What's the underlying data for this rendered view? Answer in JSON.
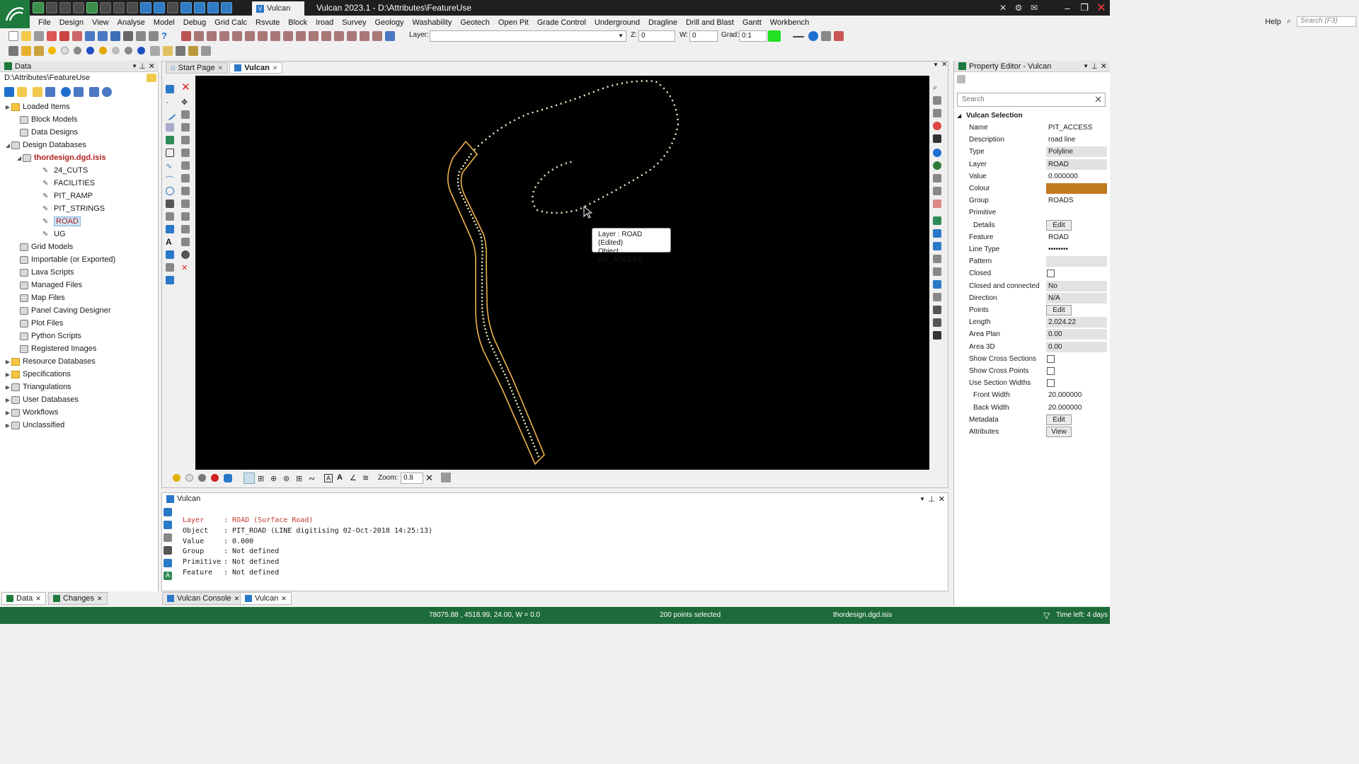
{
  "titlebar": {
    "doc_tab": "Vulcan",
    "title": "Vulcan 2023.1 - D:\\Attributes\\FeatureUse",
    "icons": [
      "tools-icon",
      "gear-icon",
      "mail-icon"
    ]
  },
  "menu": {
    "items": [
      "File",
      "Design",
      "View",
      "Analyse",
      "Model",
      "Debug",
      "Grid Calc",
      "Rsvute",
      "Block",
      "Iroad",
      "Survey",
      "Geology",
      "Washability",
      "Geotech",
      "Open Pit",
      "Grade Control",
      "Underground",
      "Dragline",
      "Drill and Blast",
      "Gantt",
      "Workbench"
    ],
    "help": "Help",
    "search_placeholder": "Search (F3)"
  },
  "toolbar": {
    "layer_label": "Layer:",
    "layer_value": "",
    "z_label": "Z:",
    "z_value": "0",
    "w_label": "W:",
    "w_value": "0",
    "grad_label": "Grad:",
    "grad_value": "0:1",
    "grad_color": "#22e022"
  },
  "data_panel": {
    "title": "Data",
    "path": "D:\\Attributes\\FeatureUse",
    "tree": [
      {
        "label": "Loaded Items",
        "expander": "▶",
        "icon": "fld"
      },
      {
        "label": "Block Models",
        "expander": "",
        "icon": "db"
      },
      {
        "label": "Data Designs",
        "expander": "",
        "icon": "db"
      },
      {
        "label": "Design Databases",
        "expander": "◢",
        "icon": "db"
      },
      {
        "label": "thordesign.dgd.isis",
        "expander": "◢",
        "icon": "db"
      },
      {
        "label": "24_CUTS",
        "expander": "",
        "icon": "lyr"
      },
      {
        "label": "FACILITIES",
        "expander": "",
        "icon": "lyr"
      },
      {
        "label": "PIT_RAMP",
        "expander": "",
        "icon": "lyr"
      },
      {
        "label": "PIT_STRINGS",
        "expander": "",
        "icon": "lyr"
      },
      {
        "label": "ROAD",
        "expander": "",
        "icon": "lyr"
      },
      {
        "label": "UG",
        "expander": "",
        "icon": "lyr"
      },
      {
        "label": "Grid Models",
        "expander": "",
        "icon": "db"
      },
      {
        "label": "Importable (or Exported)",
        "expander": "",
        "icon": "db"
      },
      {
        "label": "Lava Scripts",
        "expander": "",
        "icon": "db"
      },
      {
        "label": "Managed Files",
        "expander": "",
        "icon": "db"
      },
      {
        "label": "Map Files",
        "expander": "",
        "icon": "db"
      },
      {
        "label": "Panel Caving Designer",
        "expander": "",
        "icon": "db"
      },
      {
        "label": "Plot Files",
        "expander": "",
        "icon": "db"
      },
      {
        "label": "Python Scripts",
        "expander": "",
        "icon": "db"
      },
      {
        "label": "Registered Images",
        "expander": "",
        "icon": "db"
      },
      {
        "label": "Resource Databases",
        "expander": "▶",
        "icon": "fld"
      },
      {
        "label": "Specifications",
        "expander": "▶",
        "icon": "fld"
      },
      {
        "label": "Triangulations",
        "expander": "▶",
        "icon": "db"
      },
      {
        "label": "User Databases",
        "expander": "▶",
        "icon": "db"
      },
      {
        "label": "Workflows",
        "expander": "▶",
        "icon": "db"
      },
      {
        "label": "Unclassified",
        "expander": "▶",
        "icon": "db"
      }
    ]
  },
  "view": {
    "tabs": [
      "Start Page",
      "Vulcan"
    ],
    "zoom_label": "Zoom:",
    "zoom_value": "0.8",
    "tooltip_line1": "Layer : ROAD (Edited)",
    "tooltip_line2": "Object : PIT_ACCESS",
    "road_color": "#f0b24a",
    "line_color": "#f5f2c8"
  },
  "console": {
    "title": "Vulcan",
    "lines": [
      {
        "key": "Layer",
        "value": ": ROAD (Surface Road)"
      },
      {
        "key": "Object",
        "value": ": PIT_ROAD (LINE digitising 02-Oct-2018 14:25:13)"
      },
      {
        "key": "Value",
        "value": ": 0.000"
      },
      {
        "key": "Group",
        "value": ": Not defined"
      },
      {
        "key": "Primitive",
        "value": ": Not defined"
      },
      {
        "key": "Feature",
        "value": ": Not defined"
      }
    ]
  },
  "bottom_tabs": {
    "left": [
      "Data",
      "Changes"
    ],
    "center": [
      "Vulcan Console",
      "Vulcan"
    ]
  },
  "property_editor": {
    "title": "Property Editor - Vulcan",
    "search_placeholder": "Search",
    "section": "Vulcan Selection",
    "colour_swatch": "#c07a1e",
    "rows": [
      {
        "name": "Name",
        "value": "PIT_ACCESS",
        "kind": "text"
      },
      {
        "name": "Description",
        "value": "road line",
        "kind": "text"
      },
      {
        "name": "Type",
        "value": "Polyline",
        "kind": "ro"
      },
      {
        "name": "Layer",
        "value": "ROAD",
        "kind": "ro"
      },
      {
        "name": "Value",
        "value": "0.000000",
        "kind": "text"
      },
      {
        "name": "Colour",
        "value": "",
        "kind": "swatch"
      },
      {
        "name": "Group",
        "value": "ROADS",
        "kind": "text"
      },
      {
        "name": "Primitive",
        "value": "",
        "kind": "text"
      },
      {
        "name": "Details",
        "value": "Edit",
        "kind": "btn",
        "indent": true
      },
      {
        "name": "Feature",
        "value": "ROAD",
        "kind": "text"
      },
      {
        "name": "Line Type",
        "value": "••••••••",
        "kind": "text"
      },
      {
        "name": "Pattern",
        "value": "",
        "kind": "ro"
      },
      {
        "name": "Closed",
        "value": "",
        "kind": "chk"
      },
      {
        "name": "Closed and connected",
        "value": "No",
        "kind": "ro"
      },
      {
        "name": "Direction",
        "value": "N/A",
        "kind": "ro"
      },
      {
        "name": "Points",
        "value": "Edit",
        "kind": "btn"
      },
      {
        "name": "Length",
        "value": "2,024.22",
        "kind": "ro"
      },
      {
        "name": "Area Plan",
        "value": "0.00",
        "kind": "ro"
      },
      {
        "name": "Area 3D",
        "value": "0.00",
        "kind": "ro"
      },
      {
        "name": "Show Cross Sections",
        "value": "",
        "kind": "chk"
      },
      {
        "name": "Show Cross Points",
        "value": "",
        "kind": "chk"
      },
      {
        "name": "Use Section Widths",
        "value": "",
        "kind": "chk"
      },
      {
        "name": "Front Width",
        "value": "20.000000",
        "kind": "text",
        "indent": true
      },
      {
        "name": "Back Width",
        "value": "20.000000",
        "kind": "text",
        "indent": true
      },
      {
        "name": "Metadata",
        "value": "Edit",
        "kind": "btn"
      },
      {
        "name": "Attributes",
        "value": "View",
        "kind": "btn"
      }
    ]
  },
  "status": {
    "coords": "78075.88 , 4518.99, 24.00, W = 0.0",
    "selection": "200 points selected",
    "file": "thordesign.dgd.isis",
    "time_left": "Time left: 4 days"
  }
}
